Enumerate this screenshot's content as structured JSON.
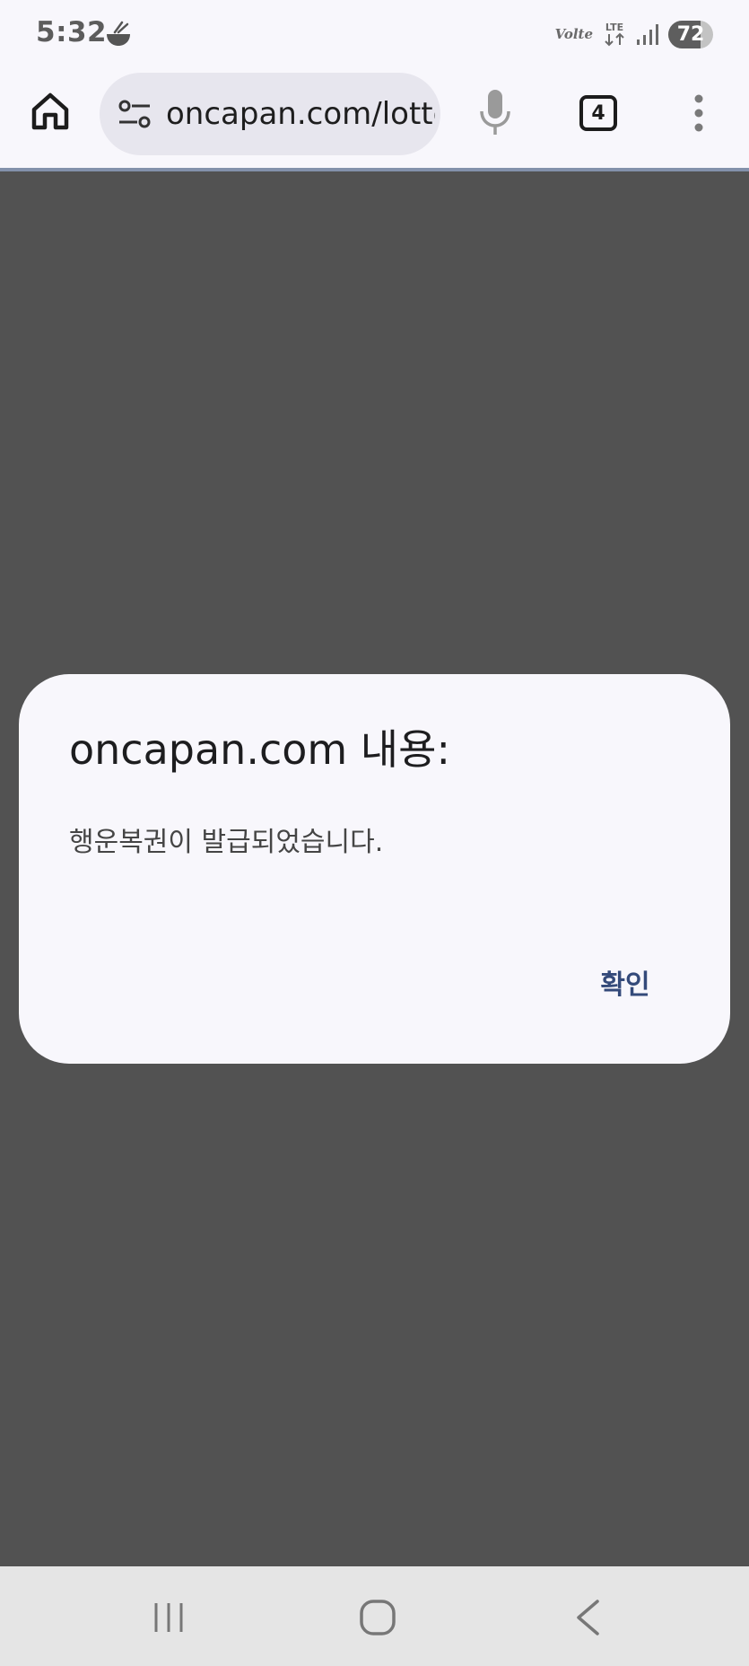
{
  "status_bar": {
    "time": "5:32",
    "app_icon": "food-bowl-icon",
    "volte_label": "Volte",
    "network_label": "LTE",
    "signal_icon": "signal-bars-icon",
    "battery_level": "72",
    "battery_fraction": 0.72
  },
  "toolbar": {
    "home_icon": "home-icon",
    "site_settings_icon": "tune-icon",
    "url": "oncapan.com/lotto",
    "mic_icon": "microphone-icon",
    "tab_count": "4",
    "menu_icon": "more-vert-icon"
  },
  "dialog": {
    "title": "oncapan.com 내용:",
    "message": "행운복권이 발급되었습니다.",
    "ok_label": "확인"
  },
  "nav_bar": {
    "recents_icon": "recents-icon",
    "home_icon": "home-circle-icon",
    "back_icon": "back-chevron-icon"
  },
  "colors": {
    "scrim": "#525252",
    "surface": "#f8f7fc",
    "url_pill": "#e7e6ee",
    "accent": "#344a7a",
    "toolbar_divider": "#8391ab",
    "nav_bar": "#e5e5e5"
  }
}
